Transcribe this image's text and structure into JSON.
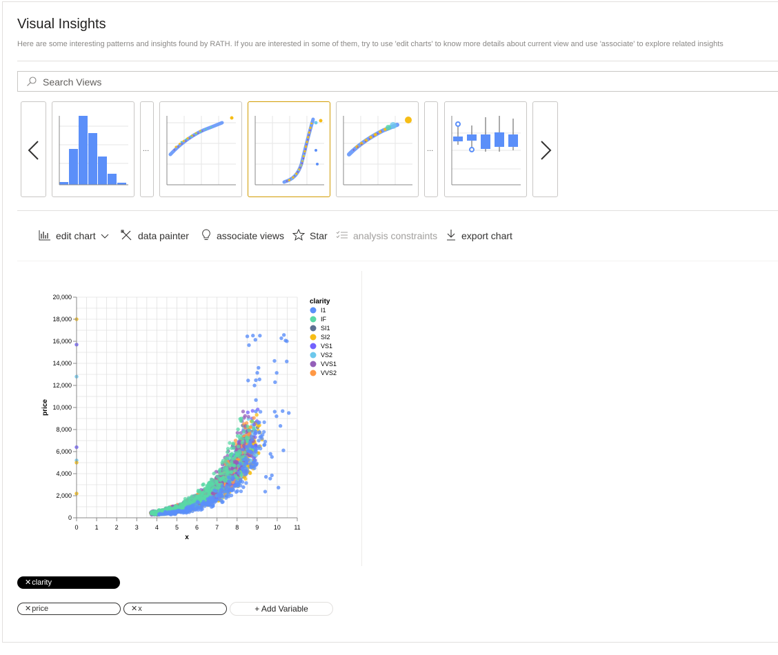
{
  "header": {
    "title": "Visual Insights",
    "subtitle": "Here are some interesting patterns and insights found by RATH. If you are interested in some of them, try to use 'edit charts' to know more details about current view and use 'associate' to explore related insights"
  },
  "search": {
    "placeholder": "Search Views"
  },
  "carousel": {
    "prev_icon": "chevron-left-icon",
    "next_icon": "chevron-right-icon",
    "ellipsis": "...",
    "thumbnails": [
      {
        "kind": "histogram"
      },
      {
        "kind": "scatter-curve"
      },
      {
        "kind": "scatter-exponential",
        "selected": true
      },
      {
        "kind": "scatter-sized"
      },
      {
        "kind": "boxplot"
      }
    ]
  },
  "toolbar": {
    "edit_chart": "edit chart",
    "data_painter": "data painter",
    "associate_views": "associate views",
    "star": "Star",
    "analysis_constraints": "analysis constraints",
    "export_chart": "export chart"
  },
  "chart_data": {
    "type": "scatter",
    "xlabel": "x",
    "ylabel": "price",
    "xlim": [
      0,
      11
    ],
    "ylim": [
      0,
      20000
    ],
    "x_ticks": [
      "0",
      "1",
      "2",
      "3",
      "4",
      "5",
      "6",
      "7",
      "8",
      "9",
      "10",
      "11"
    ],
    "y_ticks": [
      "0",
      "2,000",
      "4,000",
      "6,000",
      "8,000",
      "10,000",
      "12,000",
      "14,000",
      "16,000",
      "18,000",
      "20,000"
    ],
    "legend": {
      "title": "clarity",
      "position": "right",
      "items": [
        {
          "label": "I1",
          "color": "#5b8ff9"
        },
        {
          "label": "IF",
          "color": "#5ad8a6"
        },
        {
          "label": "SI1",
          "color": "#5d7092"
        },
        {
          "label": "SI2",
          "color": "#f6bd16"
        },
        {
          "label": "VS1",
          "color": "#7262fd"
        },
        {
          "label": "VS2",
          "color": "#6dc8ec"
        },
        {
          "label": "VVS1",
          "color": "#945fb9"
        },
        {
          "label": "VVS2",
          "color": "#ff9845"
        }
      ]
    },
    "grid": true
  },
  "encodings": {
    "color_field": "clarity",
    "row_fields": [
      "price",
      "x"
    ],
    "add_variable": "+ Add Variable"
  }
}
